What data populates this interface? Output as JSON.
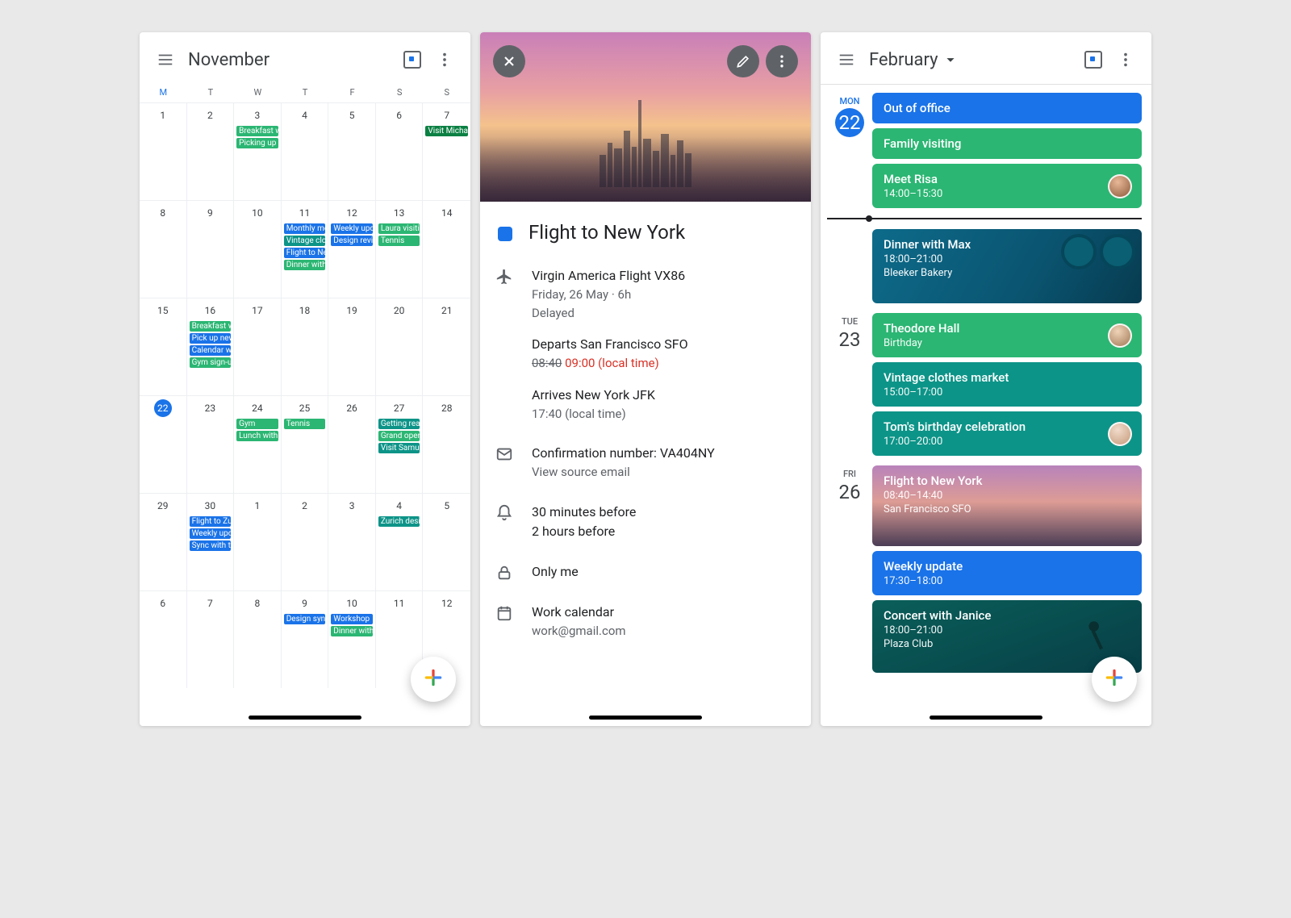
{
  "accent": "#1a73e8",
  "green": "#2bb673",
  "teal": "#0d9488",
  "screen1": {
    "title": "November",
    "weekdays": [
      "M",
      "T",
      "W",
      "T",
      "F",
      "S",
      "S"
    ],
    "weeks": [
      {
        "days": [
          {
            "n": "1"
          },
          {
            "n": "2"
          },
          {
            "n": "3",
            "ev": [
              {
                "t": "Breakfast w",
                "c": "green"
              },
              {
                "t": "Picking up",
                "c": "green"
              }
            ]
          },
          {
            "n": "4"
          },
          {
            "n": "5"
          },
          {
            "n": "6"
          },
          {
            "n": "7",
            "ev": [
              {
                "t": "Visit Micha",
                "c": "holiday"
              }
            ]
          }
        ]
      },
      {
        "days": [
          {
            "n": "8"
          },
          {
            "n": "9"
          },
          {
            "n": "10"
          },
          {
            "n": "11",
            "ev": [
              {
                "t": "Monthly me",
                "c": "blue"
              },
              {
                "t": "Vintage clo",
                "c": "teal"
              },
              {
                "t": "Flight to Ne",
                "c": "blue"
              },
              {
                "t": "Dinner with",
                "c": "green"
              }
            ]
          },
          {
            "n": "12",
            "ev": [
              {
                "t": "Weekly upd",
                "c": "blue"
              },
              {
                "t": "Design revi",
                "c": "blue"
              }
            ]
          },
          {
            "n": "13",
            "ev": [
              {
                "t": "Laura visiti",
                "c": "green"
              },
              {
                "t": "Tennis",
                "c": "green"
              }
            ]
          },
          {
            "n": "14"
          }
        ]
      },
      {
        "days": [
          {
            "n": "15"
          },
          {
            "n": "16",
            "ev": [
              {
                "t": "Breakfast w",
                "c": "green"
              },
              {
                "t": "Pick up new",
                "c": "blue"
              },
              {
                "t": "Calendar w",
                "c": "blue"
              },
              {
                "t": "Gym sign-u",
                "c": "green"
              }
            ]
          },
          {
            "n": "17"
          },
          {
            "n": "18"
          },
          {
            "n": "19"
          },
          {
            "n": "20"
          },
          {
            "n": "21"
          }
        ]
      },
      {
        "days": [
          {
            "n": "22",
            "today": true
          },
          {
            "n": "23"
          },
          {
            "n": "24",
            "ev": [
              {
                "t": "Gym",
                "c": "green"
              },
              {
                "t": "Lunch with",
                "c": "green"
              }
            ]
          },
          {
            "n": "25",
            "ev": [
              {
                "t": "Tennis",
                "c": "green"
              }
            ]
          },
          {
            "n": "26"
          },
          {
            "n": "27",
            "ev": [
              {
                "t": "Getting rea",
                "c": "teal"
              },
              {
                "t": "Grand open",
                "c": "green"
              },
              {
                "t": "Visit Samue",
                "c": "teal"
              }
            ]
          },
          {
            "n": "28"
          }
        ]
      },
      {
        "days": [
          {
            "n": "29"
          },
          {
            "n": "30",
            "ev": [
              {
                "t": "Flight to Zu",
                "c": "blue"
              },
              {
                "t": "Weekly upd",
                "c": "blue"
              },
              {
                "t": "Sync with t",
                "c": "blue"
              }
            ]
          },
          {
            "n": "1"
          },
          {
            "n": "2"
          },
          {
            "n": "3"
          },
          {
            "n": "4",
            "ev": [
              {
                "t": "Zurich desi",
                "c": "teal"
              }
            ]
          },
          {
            "n": "5"
          }
        ]
      },
      {
        "days": [
          {
            "n": "6"
          },
          {
            "n": "7"
          },
          {
            "n": "8"
          },
          {
            "n": "9",
            "ev": [
              {
                "t": "Design syn",
                "c": "blue"
              }
            ]
          },
          {
            "n": "10",
            "ev": [
              {
                "t": "Workshop",
                "c": "blue"
              },
              {
                "t": "Dinner with",
                "c": "green"
              }
            ]
          },
          {
            "n": "11"
          },
          {
            "n": "12"
          }
        ]
      }
    ]
  },
  "screen2": {
    "title": "Flight to New York",
    "flight_line": "Virgin America Flight VX86",
    "flight_date": "Friday, 26 May  ·  6h",
    "flight_status": "Delayed",
    "depart_head": "Departs San Francisco SFO",
    "depart_old": "08:40",
    "depart_new": "09:00 (local time)",
    "arrive_head": "Arrives New York JFK",
    "arrive_time": "17:40 (local time)",
    "confirmation": "Confirmation number: VA404NY",
    "view_source": "View source email",
    "reminder1": "30 minutes before",
    "reminder2": "2 hours before",
    "visibility": "Only me",
    "calendar_name": "Work calendar",
    "calendar_email": "work@gmail.com"
  },
  "screen3": {
    "title": "February",
    "days": [
      {
        "label": "MON",
        "num": "22",
        "today": true,
        "cards": [
          {
            "style": "blue",
            "title": "Out of office"
          },
          {
            "style": "green",
            "title": "Family visiting"
          },
          {
            "style": "green",
            "title": "Meet Risa",
            "time": "14:00–15:30",
            "avatar": "a1"
          },
          {
            "now": true
          },
          {
            "style": "dinner",
            "title": "Dinner with Max",
            "time": "18:00–21:00",
            "loc": "Bleeker Bakery"
          }
        ]
      },
      {
        "label": "TUE",
        "num": "23",
        "cards": [
          {
            "style": "green",
            "title": "Theodore Hall",
            "time": "Birthday",
            "avatar": "a2"
          },
          {
            "style": "teal",
            "title": "Vintage clothes market",
            "time": "15:00–17:00"
          },
          {
            "style": "teal",
            "title": "Tom's birthday celebration",
            "time": "17:00–20:00",
            "avatar": "a3"
          }
        ]
      },
      {
        "label": "FRI",
        "num": "26",
        "cards": [
          {
            "style": "flight",
            "title": "Flight to New York",
            "time": "08:40–14:40",
            "loc": "San Francisco SFO"
          },
          {
            "style": "blue",
            "title": "Weekly update",
            "time": "17:30–18:00"
          },
          {
            "style": "concert",
            "title": "Concert with Janice",
            "time": "18:00–21:00",
            "loc": "Plaza Club"
          }
        ]
      }
    ]
  }
}
